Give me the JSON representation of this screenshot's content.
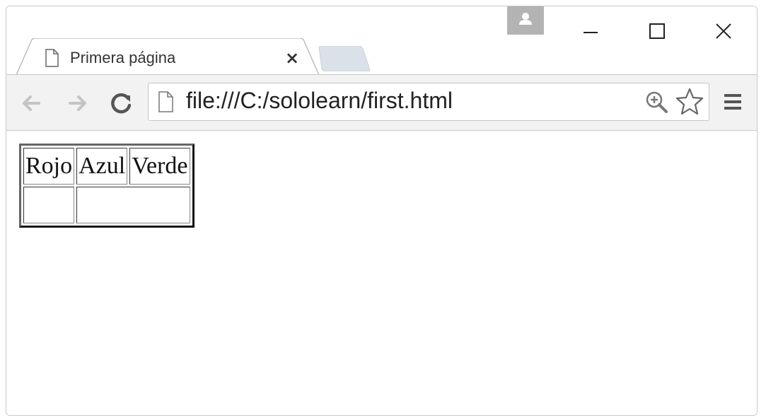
{
  "browser": {
    "tab": {
      "title": "Primera página",
      "close": "×"
    },
    "address_bar": {
      "url": "file:///C:/sololearn/first.html"
    }
  },
  "page": {
    "table": {
      "header_row": [
        "Rojo",
        "Azul",
        "Verde"
      ],
      "second_row": [
        "",
        ""
      ]
    }
  }
}
